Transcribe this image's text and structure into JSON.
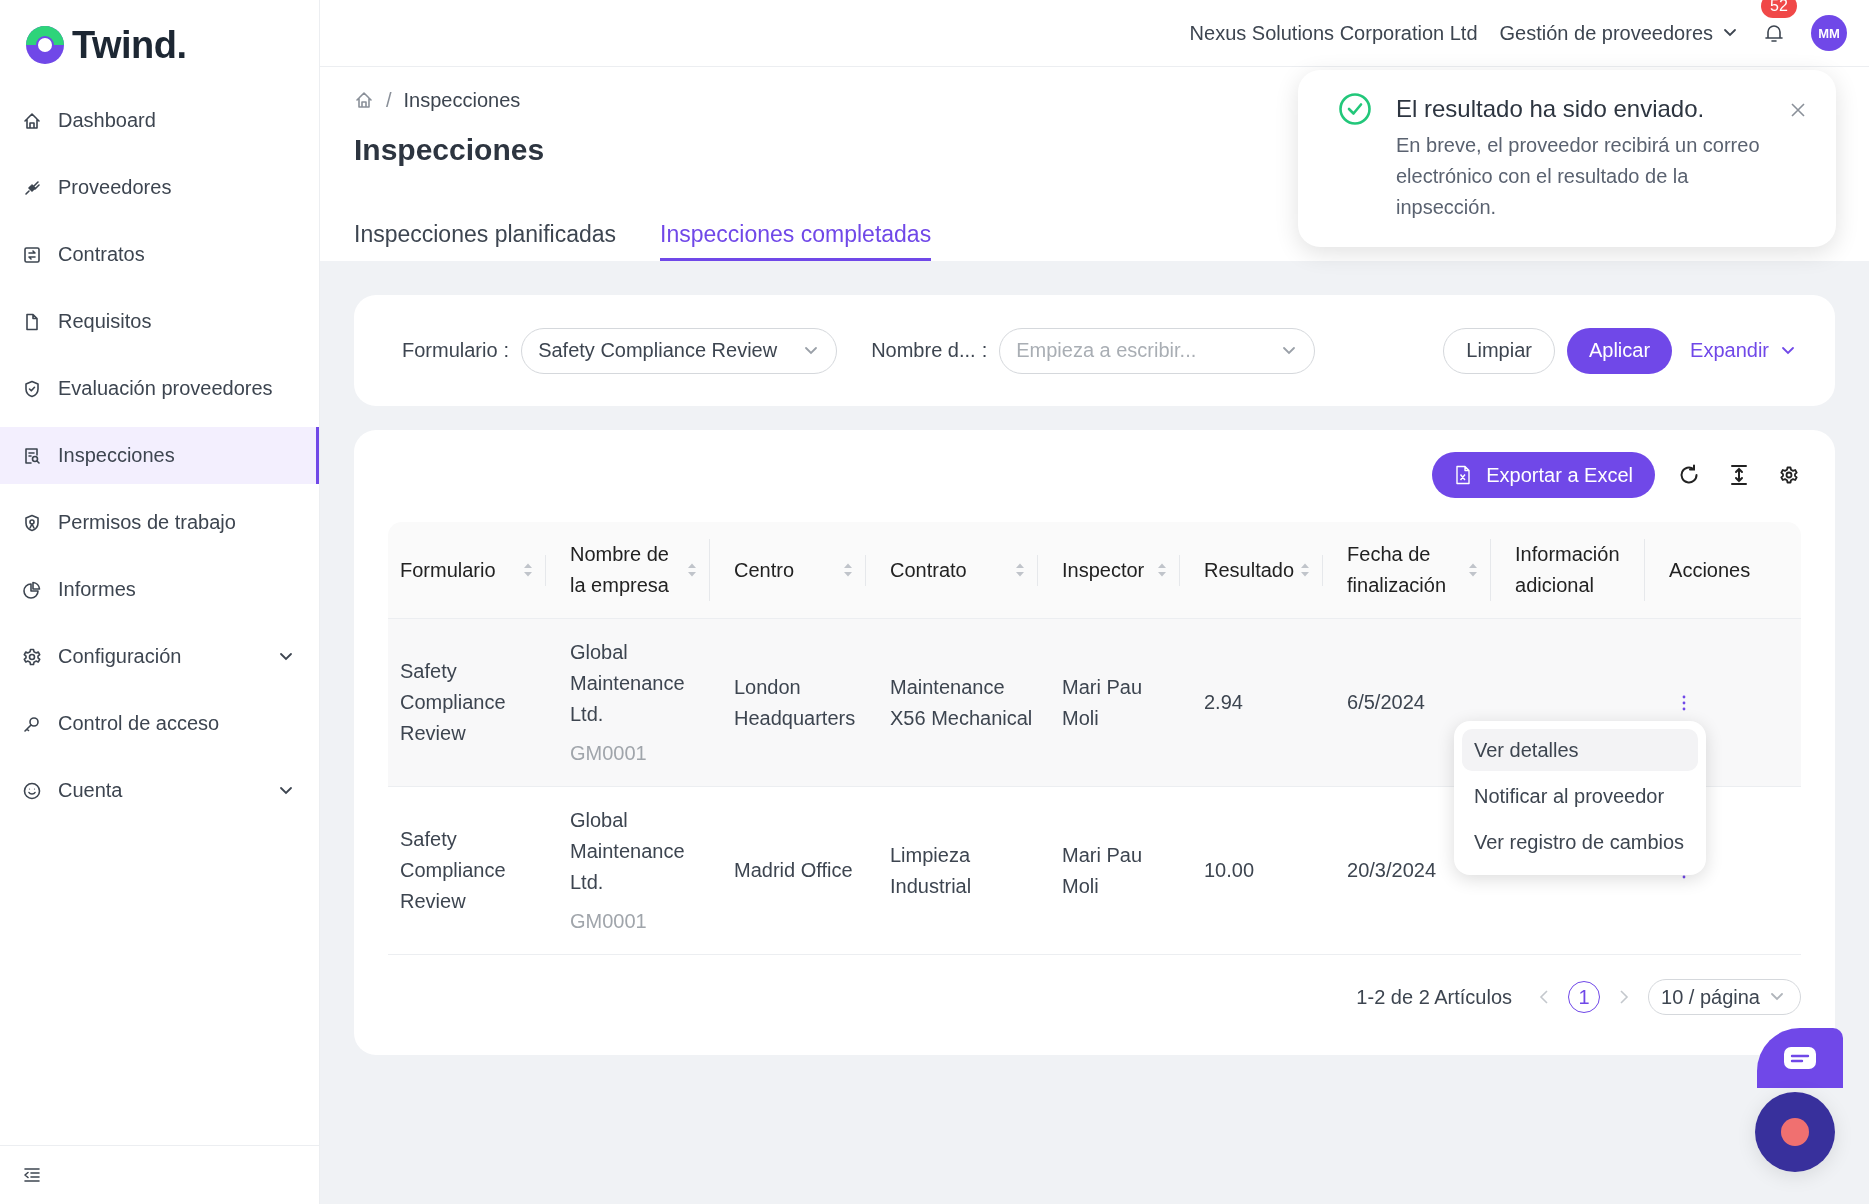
{
  "logo": {
    "text": "Twind."
  },
  "sidebar": {
    "items": [
      {
        "label": "Dashboard",
        "selected": false,
        "has_submenu": false
      },
      {
        "label": "Proveedores",
        "selected": false,
        "has_submenu": false
      },
      {
        "label": "Contratos",
        "selected": false,
        "has_submenu": false
      },
      {
        "label": "Requisitos",
        "selected": false,
        "has_submenu": false
      },
      {
        "label": "Evaluación proveedores",
        "selected": false,
        "has_submenu": false
      },
      {
        "label": "Inspecciones",
        "selected": true,
        "has_submenu": false
      },
      {
        "label": "Permisos de trabajo",
        "selected": false,
        "has_submenu": false
      },
      {
        "label": "Informes",
        "selected": false,
        "has_submenu": false
      },
      {
        "label": "Configuración",
        "selected": false,
        "has_submenu": true
      },
      {
        "label": "Control de acceso",
        "selected": false,
        "has_submenu": false
      },
      {
        "label": "Cuenta",
        "selected": false,
        "has_submenu": true
      }
    ]
  },
  "header": {
    "company": "Nexus Solutions Corporation Ltd",
    "module": "Gestión de proveedores",
    "notifications": "52",
    "avatar": "MM"
  },
  "breadcrumb": {
    "separator": "/",
    "items": [
      "Inspecciones"
    ]
  },
  "title": "Inspecciones",
  "tabs": [
    {
      "label": "Inspecciones planificadas",
      "selected": false
    },
    {
      "label": "Inspecciones completadas",
      "selected": true
    }
  ],
  "filters": [
    {
      "label": "Formulario",
      "separator": ":",
      "value": "Safety Compliance Review"
    },
    {
      "label": "Nombre d...",
      "separator": ":",
      "placeholder": "Empieza a escribir..."
    }
  ],
  "filter_buttons": {
    "clear": "Limpiar",
    "apply": "Aplicar",
    "expand": "Expandir"
  },
  "toolbar": {
    "export": "Exportar a Excel"
  },
  "table": {
    "columns": [
      {
        "label": "Formulario",
        "sortable": true
      },
      {
        "label": "Nombre de la empresa",
        "sortable": true
      },
      {
        "label": "Centro",
        "sortable": true
      },
      {
        "label": "Contrato",
        "sortable": true
      },
      {
        "label": "Inspector",
        "sortable": true
      },
      {
        "label": "Resultado",
        "sortable": true
      },
      {
        "label": "Fecha de finalización",
        "sortable": true
      },
      {
        "label": "Información adicional",
        "sortable": false
      },
      {
        "label": "Acciones",
        "sortable": false
      }
    ],
    "rows": [
      {
        "highlighted": true,
        "formulario": "Safety Compliance Review",
        "empresa": "Global Maintenance Ltd.",
        "codigo": "GM0001",
        "centro": "London Headquarters",
        "contrato": "Maintenance X56 Mechanical",
        "inspector": "Mari Pau Moli",
        "resultado": "2.94",
        "fecha": "6/5/2024"
      },
      {
        "highlighted": false,
        "formulario": "Safety Compliance Review",
        "empresa": "Global Maintenance Ltd.",
        "codigo": "GM0001",
        "centro": "Madrid Office",
        "contrato": "Limpieza Industrial",
        "inspector": "Mari Pau Moli",
        "resultado": "10.00",
        "fecha": "20/3/2024"
      }
    ]
  },
  "row_menu": {
    "items": [
      {
        "label": "Ver detalles",
        "selected": true
      },
      {
        "label": "Notificar al proveedor",
        "selected": false
      },
      {
        "label": "Ver registro de cambios",
        "selected": false
      }
    ]
  },
  "pagination": {
    "summary": "1-2 de 2 Artículos",
    "pages": [
      {
        "label": "1",
        "selected": true
      }
    ],
    "page_size": "10 / página"
  },
  "toast": {
    "title": "El resultado ha sido enviado.",
    "message": "En breve, el proveedor recibirá un correo electrónico con el resultado de la inpsección."
  }
}
